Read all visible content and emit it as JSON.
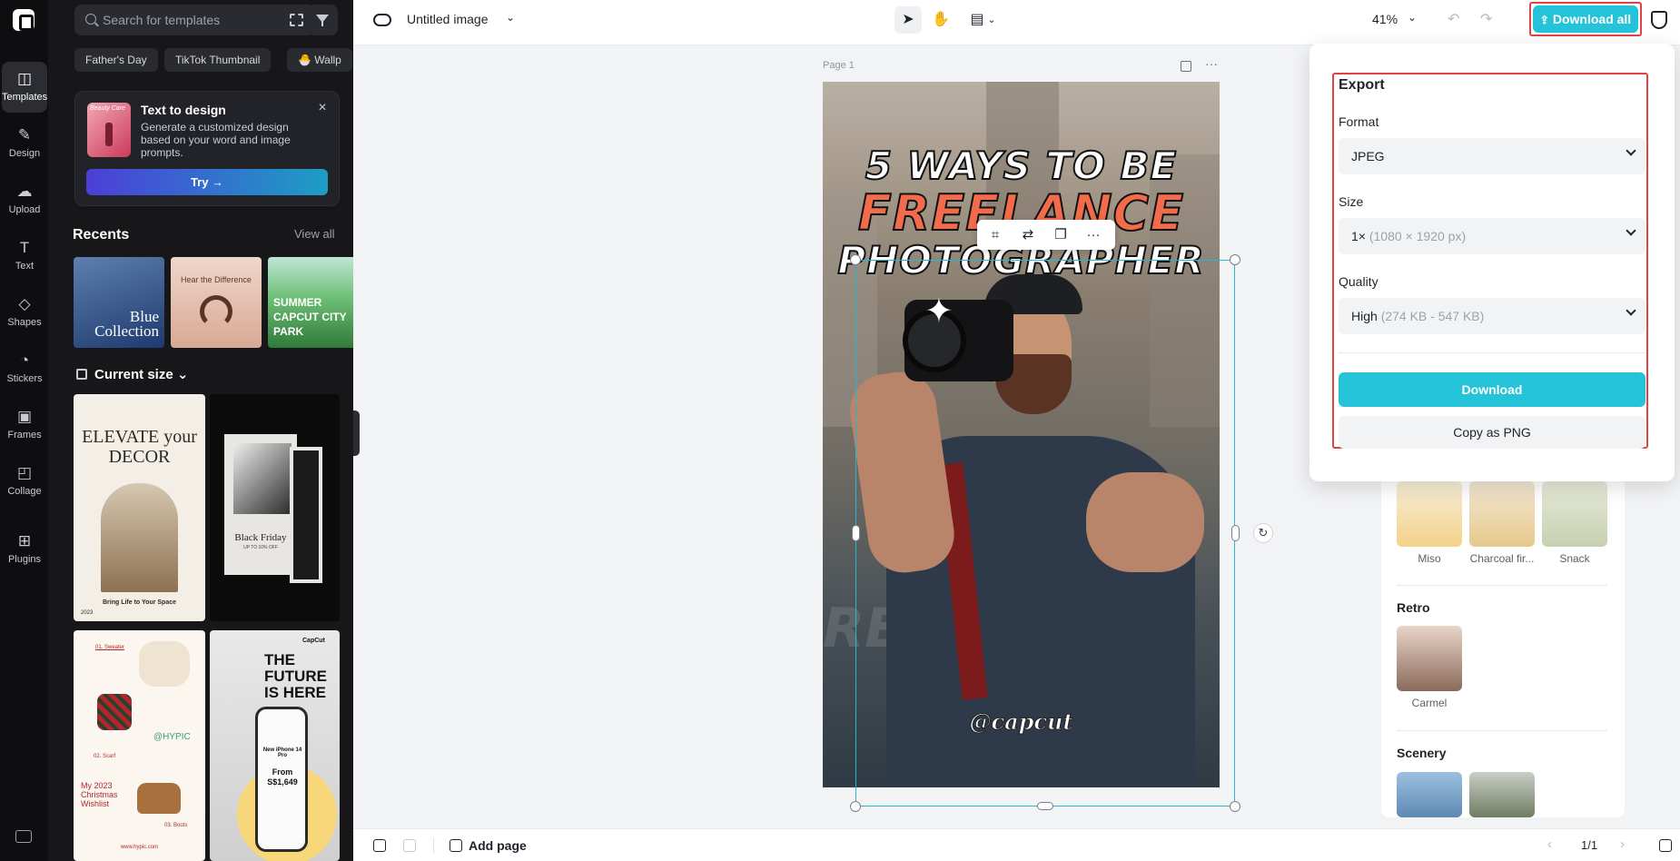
{
  "rail": {
    "items": [
      {
        "label": "Templates",
        "icon": "templates-icon",
        "glyph": "◫"
      },
      {
        "label": "Design",
        "icon": "design-icon",
        "glyph": "✎"
      },
      {
        "label": "Upload",
        "icon": "upload-icon",
        "glyph": "☁"
      },
      {
        "label": "Text",
        "icon": "text-icon",
        "glyph": "T"
      },
      {
        "label": "Shapes",
        "icon": "shapes-icon",
        "glyph": "◇"
      },
      {
        "label": "Stickers",
        "icon": "stickers-icon",
        "glyph": "◔"
      },
      {
        "label": "Frames",
        "icon": "frames-icon",
        "glyph": "▣"
      },
      {
        "label": "Collage",
        "icon": "collage-icon",
        "glyph": "◰"
      },
      {
        "label": "Plugins",
        "icon": "plugins-icon",
        "glyph": "⊞"
      }
    ]
  },
  "panel": {
    "search_placeholder": "Search for templates",
    "chips": [
      "Father's Day",
      "TikTok Thumbnail",
      "🐣 Wallp"
    ],
    "text_to_design": {
      "thumb_label": "Beauty Care",
      "title": "Text to design",
      "description": "Generate a customized design based on your word and image prompts.",
      "try_label": "Try →"
    },
    "recents_title": "Recents",
    "view_all": "View all",
    "recents": [
      {
        "text": "Blue Collection",
        "color": "#1f3a6e"
      },
      {
        "text": "Hear the Difference",
        "color": "#e3c0b0"
      },
      {
        "text": "SUMMER CAPCUT CITY PARK",
        "color": "#3e8a4a"
      }
    ],
    "current_size": "Current size ⌄",
    "templates": [
      {
        "title": "ELEVATE your DECOR",
        "sub": "Bring Life to Your Space",
        "year": "2023"
      },
      {
        "title": "Black Friday",
        "sub": "UP TO 10% OFF"
      },
      {
        "title": "My 2023 Christmas Wishlist",
        "tag": "@HYPIC",
        "items": [
          "01. Sweater",
          "02. Scarf",
          "03. Boots"
        ],
        "url": "www.hypic.com"
      },
      {
        "title": "THE FUTURE IS HERE",
        "brand": "CapCut",
        "phone": "New iPhone 14 Pro",
        "price": "From S$1,649"
      }
    ]
  },
  "topbar": {
    "doc_title": "Untitled image",
    "zoom": "41%",
    "download_all": "Download all"
  },
  "canvas": {
    "page_label": "Page 1",
    "headline_1": "5 WAYS TO BE",
    "headline_2": "FREELANCE",
    "headline_3": "PHOTOGRAPHER",
    "handle": "@capcut",
    "watermark": "REST AWAY"
  },
  "bottombar": {
    "add_page": "Add page",
    "pager": "1/1"
  },
  "filters": {
    "row1": [
      {
        "label": "Miso",
        "color": "#f3d28a"
      },
      {
        "label": "Charcoal fir...",
        "color": "#e7c98c"
      },
      {
        "label": "Snack",
        "color": "#d9e0c9"
      }
    ],
    "retro_title": "Retro",
    "retro": [
      {
        "label": "Carmel",
        "color": "#c9a28f"
      }
    ],
    "scenery_title": "Scenery",
    "scenery": [
      {
        "color": "#7fa6c9"
      },
      {
        "color": "#8f9b86"
      }
    ]
  },
  "export": {
    "title": "Export",
    "format_label": "Format",
    "format_value": "JPEG",
    "size_label": "Size",
    "size_value": "1×",
    "size_detail": "(1080 × 1920 px)",
    "quality_label": "Quality",
    "quality_value": "High",
    "quality_detail": "(274 KB - 547 KB)",
    "download": "Download",
    "copy_png": "Copy as PNG"
  },
  "colors": {
    "accent": "#25c3d8",
    "highlight": "#e04343",
    "selection": "#25b9cf"
  }
}
